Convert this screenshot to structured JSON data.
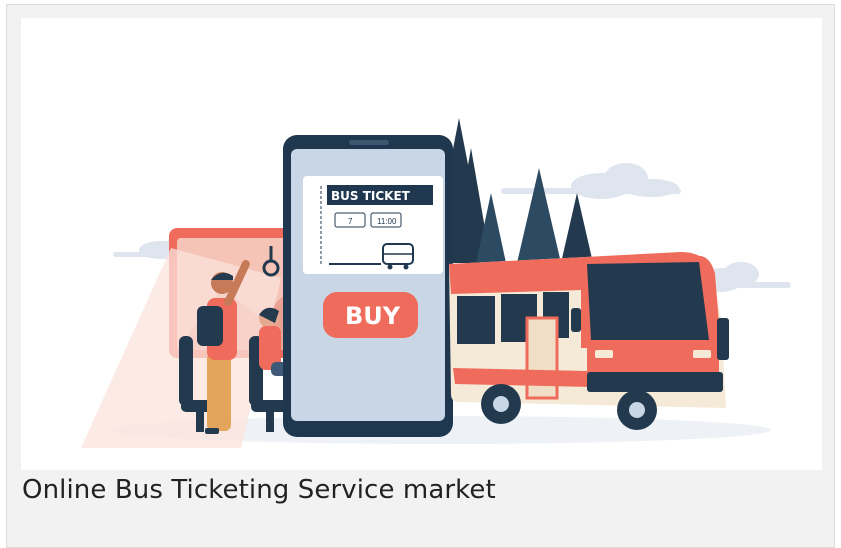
{
  "illustration": {
    "ticket_title": "BUS TICKET",
    "ticket_field_1": "7",
    "ticket_field_2": "11:00",
    "buy_button_label": "BUY",
    "colors": {
      "phone_body": "#20384f",
      "phone_screen": "#c8d6e5",
      "buy_accent": "#ef6b5c",
      "bus_red": "#ef6b5c",
      "bus_cream": "#f5ead8",
      "tree_dark": "#233a4e",
      "cloud": "#dfe5ee"
    }
  },
  "caption": {
    "text": "Online Bus Ticketing Service market"
  }
}
